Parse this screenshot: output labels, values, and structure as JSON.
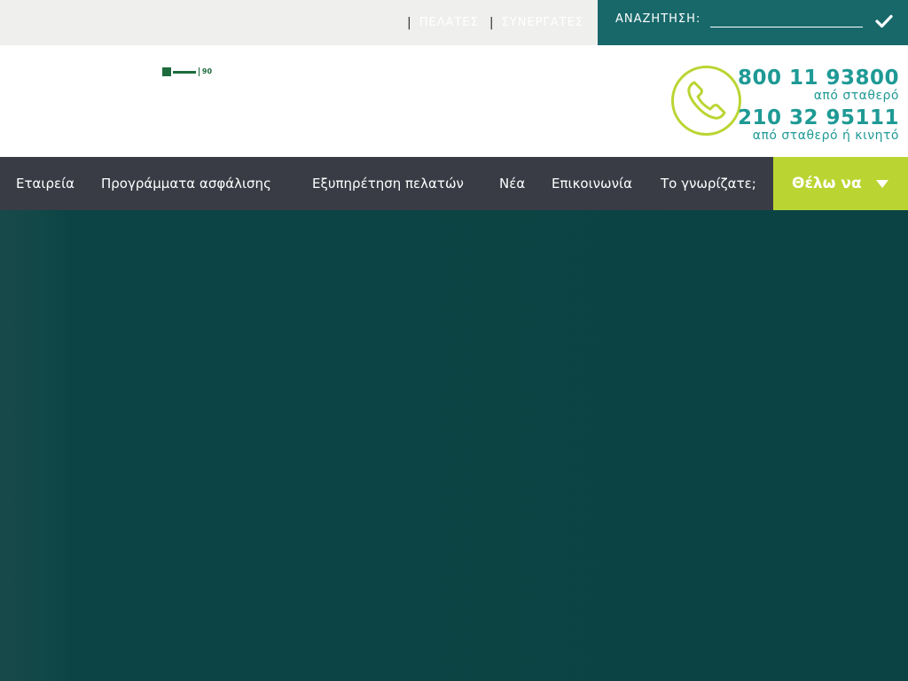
{
  "topbar": {
    "links": [
      {
        "label": "ΠΕΛΑΤΕΣ",
        "separator": "|"
      },
      {
        "label": "ΣΥΝΕΡΓΑΤΕΣ",
        "separator": "|"
      }
    ],
    "search": {
      "label": "ΑΝΑΖΗΤΗΣΗ:",
      "value": "",
      "submit_icon": "check-icon"
    }
  },
  "header": {
    "logo_icon": "groupama-logo",
    "phones": [
      {
        "number": "800 11 93800",
        "note": "από σταθερό"
      },
      {
        "number": "210 32 95111",
        "note": "από σταθερό ή κινητό"
      }
    ],
    "phone_icon": "phone-icon"
  },
  "nav": {
    "items": [
      {
        "label": "Εταιρεία"
      },
      {
        "label": "Προγράμματα ασφάλισης"
      },
      {
        "label": "Εξυπηρέτηση πελατών"
      },
      {
        "label": "Νέα"
      },
      {
        "label": "Επικοινωνία"
      },
      {
        "label": "Το γνωρίζατε;"
      }
    ],
    "cta": {
      "label": "Θέλω να",
      "icon": "caret-down-icon"
    }
  },
  "colors": {
    "topbar_bg": "#efefed",
    "search_bg": "#18686a",
    "accent_teal": "#1f9a95",
    "lime": "#bad532",
    "nav_bg": "#393c45",
    "hero_bg": "#0b4344"
  }
}
